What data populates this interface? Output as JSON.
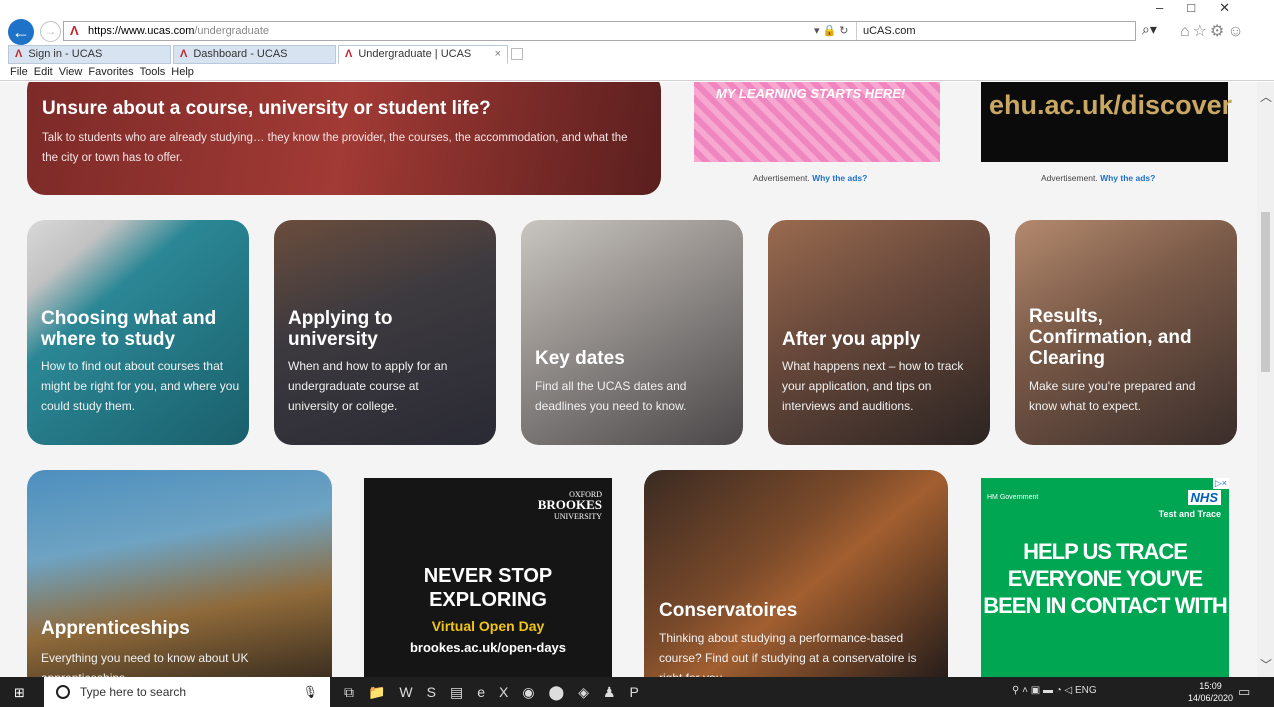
{
  "browser": {
    "url_host": "https://www.ucas.com",
    "url_path": "/undergraduate",
    "site_name": "uCAS.com",
    "tabs": [
      {
        "label": "Sign in - UCAS"
      },
      {
        "label": "Dashboard - UCAS"
      },
      {
        "label": "Undergraduate | UCAS"
      }
    ],
    "menu": [
      "File",
      "Edit",
      "View",
      "Favorites",
      "Tools",
      "Help"
    ]
  },
  "banner": {
    "title": "Unsure about a course, university or student life?",
    "text": "Talk to students who are already studying… they know the provider, the courses, the accommodation, and what the the city or town has to offer."
  },
  "ads_top": {
    "ad1_text": "MY LEARNING STARTS HERE!",
    "ad2_text": "ehu.ac.uk/discover",
    "label": "Advertisement.",
    "why": "Why the ads?"
  },
  "cards": [
    {
      "title": "Choosing what and where to study",
      "text": "How to find out about courses that might be right for you, and where you could study them."
    },
    {
      "title": "Applying to university",
      "text": "When and how to apply for an undergraduate course at university or college."
    },
    {
      "title": "Key dates",
      "text": "Find all the UCAS dates and deadlines you need to know."
    },
    {
      "title": "After you apply",
      "text": "What happens next – how to track your application, and tips on interviews and auditions."
    },
    {
      "title": "Results, Confirmation, and Clearing",
      "text": "Make sure you're prepared and know what to expect."
    }
  ],
  "bottom": {
    "apprenticeships": {
      "title": "Apprenticeships",
      "text": "Everything you need to know about UK apprenticeships."
    },
    "brookes": {
      "oxford": "OXFORD",
      "name": "BROOKES",
      "uni": "UNIVERSITY",
      "headline": "NEVER STOP EXPLORING",
      "sub": "Virtual Open Day",
      "url": "brookes.ac.uk/open-days"
    },
    "conservatoires": {
      "title": "Conservatoires",
      "text": "Thinking about studying a performance-based course? Find out if studying at a conservatoire is right for you."
    },
    "nhs": {
      "gov": "HM Government",
      "logo": "NHS",
      "tt": "Test and Trace",
      "headline": "HELP US TRACE EVERYONE YOU'VE BEEN IN CONTACT WITH"
    }
  },
  "taskbar": {
    "search_placeholder": "Type here to search",
    "lang": "ENG",
    "time": "15:09",
    "date": "14/06/2020"
  }
}
